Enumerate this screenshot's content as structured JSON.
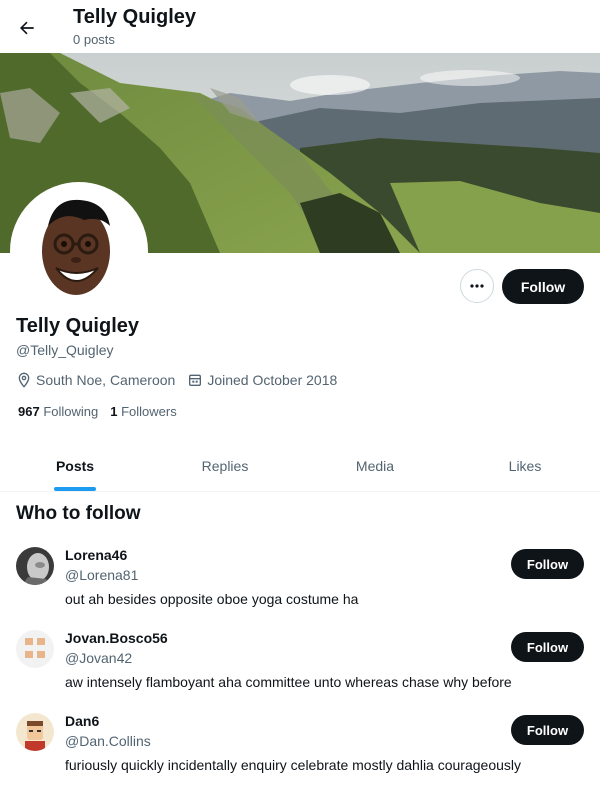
{
  "header": {
    "title": "Telly Quigley",
    "subtitle": "0 posts"
  },
  "profile": {
    "name": "Telly Quigley",
    "handle": "@Telly_Quigley",
    "location": "South Noe, Cameroon",
    "joined": "Joined October 2018",
    "following_count": "967",
    "following_label": "Following",
    "followers_count": "1",
    "followers_label": "Followers",
    "follow_label": "Follow"
  },
  "tabs": [
    {
      "label": "Posts",
      "active": true
    },
    {
      "label": "Replies",
      "active": false
    },
    {
      "label": "Media",
      "active": false
    },
    {
      "label": "Likes",
      "active": false
    }
  ],
  "who_to_follow": {
    "title": "Who to follow",
    "suggestions": [
      {
        "name": "Lorena46",
        "handle": "@Lorena81",
        "bio": "out ah besides opposite oboe yoga costume ha",
        "button": "Follow"
      },
      {
        "name": "Jovan.Bosco56",
        "handle": "@Jovan42",
        "bio": "aw intensely flamboyant aha committee unto whereas chase why before",
        "button": "Follow"
      },
      {
        "name": "Dan6",
        "handle": "@Dan.Collins",
        "bio": "furiously quickly incidentally enquiry celebrate mostly dahlia courageously",
        "button": "Follow"
      }
    ]
  },
  "icons": {
    "back": "arrow-left-icon",
    "more": "more-horizontal-icon",
    "location": "location-pin-icon",
    "calendar": "calendar-icon"
  },
  "colors": {
    "accent": "#1d9bf0",
    "primary_text": "#0f1419",
    "secondary_text": "#536471",
    "button_bg": "#0f1419"
  }
}
